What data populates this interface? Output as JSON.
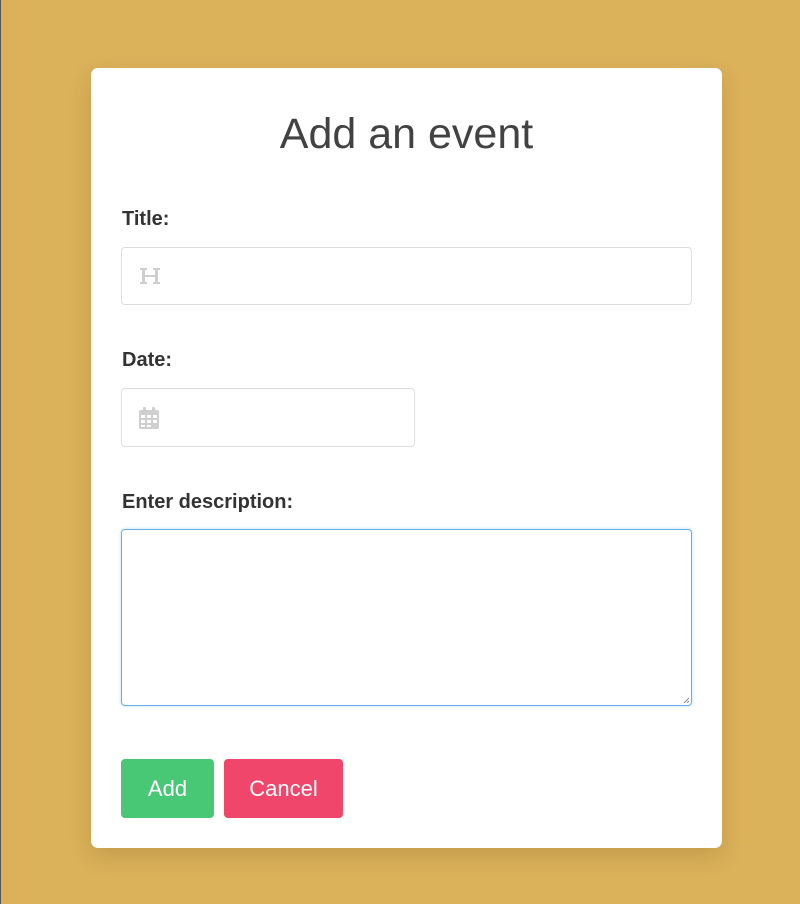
{
  "colors": {
    "background": "#dbb15a",
    "card": "#ffffff",
    "add_button": "#48c774",
    "cancel_button": "#f0466b",
    "textarea_focus_border": "#66afe9"
  },
  "form": {
    "title": "Add an event",
    "title_field": {
      "label": "Title:",
      "value": "",
      "placeholder": "",
      "icon": "heading-icon"
    },
    "date_field": {
      "label": "Date:",
      "value": "",
      "placeholder": "",
      "icon": "calendar-icon"
    },
    "description_field": {
      "label": "Enter description:",
      "value": "",
      "placeholder": ""
    },
    "buttons": {
      "add_label": "Add",
      "cancel_label": "Cancel"
    }
  }
}
